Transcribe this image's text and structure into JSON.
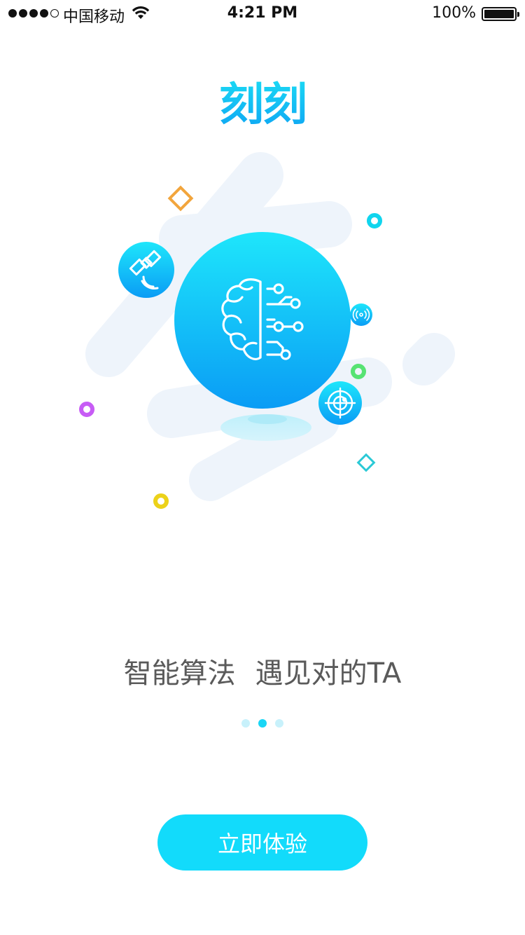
{
  "status_bar": {
    "carrier": "中国移动",
    "time": "4:21 PM",
    "battery": "100%",
    "signal_bars": 4,
    "wifi_icon": "wifi-icon"
  },
  "app": {
    "logo_text": "刻刻",
    "brand_color": "#12dbfb"
  },
  "illustration": {
    "center_icon": "brain-circuit-icon",
    "badges": [
      "satellite-icon",
      "radar-icon",
      "signal-icon"
    ]
  },
  "onboarding": {
    "caption_part1": "智能算法",
    "caption_part2": "遇见对的TA",
    "page_count": 3,
    "active_page": 2
  },
  "cta": {
    "label": "立即体验"
  }
}
